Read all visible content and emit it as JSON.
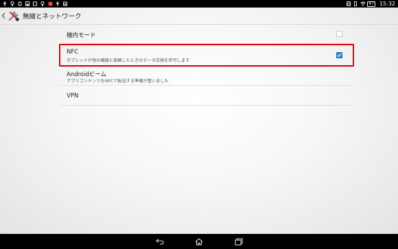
{
  "status_bar": {
    "battery": "47",
    "time": "15:32",
    "notification_icons": [
      "usb-icon",
      "bulb-icon",
      "usb-debug-icon",
      "download-icon",
      "screenshot-icon",
      "bulb-icon",
      "app-notification-icon",
      "usb-icon",
      "image-icon"
    ],
    "system_icons": [
      "nfc-icon",
      "vibrate-icon",
      "wifi-icon",
      "battery-icon"
    ]
  },
  "action_bar": {
    "title": "無線とネットワーク",
    "icons": [
      "up-arrow-icon",
      "settings-tools-icon"
    ]
  },
  "settings": [
    {
      "title": "機内モード",
      "summary": "",
      "checked": false
    },
    {
      "title": "NFC",
      "summary": "タブレットが他の機器と接触したときのデータ交換を許可します",
      "checked": true
    },
    {
      "title": "Androidビーム",
      "summary": "アプリコンテンツをNFCで転送する準備が整いました"
    },
    {
      "title": "VPN",
      "summary": ""
    }
  ],
  "highlight": {
    "color": "#e00000",
    "target": "NFC"
  },
  "accent_color": "#2b82d9",
  "nav_bar": {
    "icons": [
      "back-icon",
      "home-icon",
      "recent-apps-icon"
    ]
  }
}
